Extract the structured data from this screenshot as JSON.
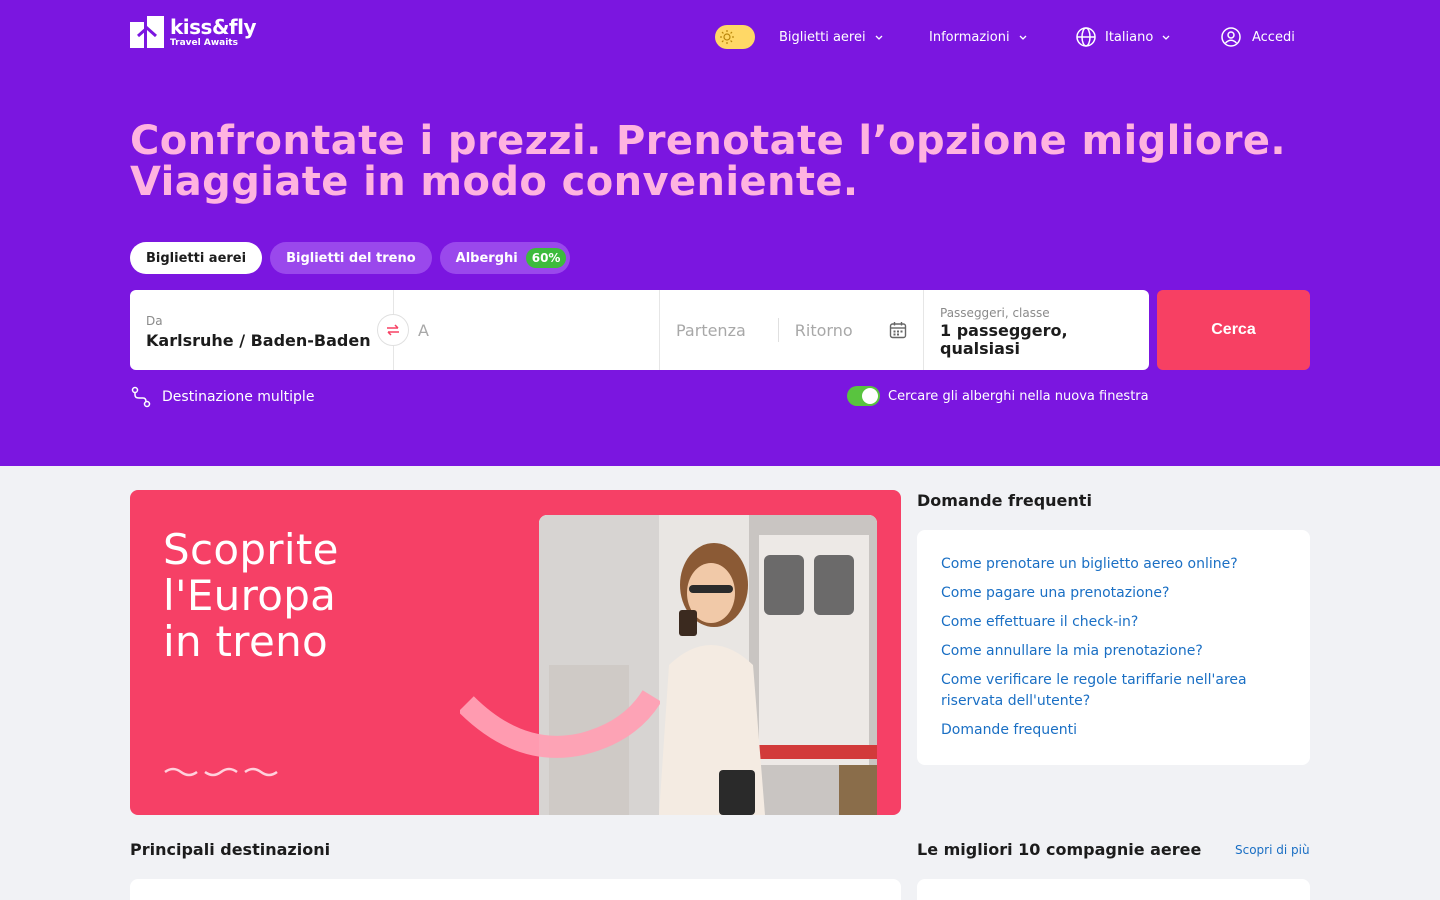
{
  "header": {
    "logo_name": "kiss&fly",
    "logo_tagline": "Travel Awaits",
    "nav": [
      {
        "label": "Biglietti aerei"
      },
      {
        "label": "Informazioni"
      },
      {
        "label": "Italiano"
      },
      {
        "label": "Accedi"
      }
    ]
  },
  "hero": {
    "title_line1": "Confrontate i prezzi. Prenotate l’opzione migliore.",
    "title_line2": "Viaggiate in modo conveniente."
  },
  "tabs": [
    {
      "label": "Biglietti aerei",
      "active": true
    },
    {
      "label": "Biglietti del treno",
      "active": false
    },
    {
      "label": "Alberghi",
      "badge": "60%",
      "active": false
    }
  ],
  "search": {
    "from_label": "Da",
    "from_value": "Karlsruhe / Baden-Baden",
    "to_placeholder": "A",
    "depart_placeholder": "Partenza",
    "return_placeholder": "Ritorno",
    "pax_label": "Passeggeri, classe",
    "pax_value": "1 passeggero, qualsiasi",
    "button": "Cerca",
    "multi_label": "Destinazione multiple",
    "hotel_toggle_label": "Cercare gli alberghi nella nuova finestra",
    "hotel_toggle_on": true
  },
  "banner": {
    "line1": "Scoprite",
    "line2": "l'Europa",
    "line3": "in treno"
  },
  "faq": {
    "title": "Domande frequenti",
    "items": [
      "Come prenotare un biglietto aereo online?",
      "Come pagare una prenotazione?",
      "Come effettuare il check-in?",
      "Come annullare la mia prenotazione?",
      "Come verificare le regole tariffarie nell'area riservata dell'utente?",
      "Domande frequenti"
    ]
  },
  "sections": {
    "destinations_title": "Principali destinazioni",
    "airlines_title": "Le migliori 10 compagnie aeree",
    "airlines_more": "Scopri di più"
  },
  "colors": {
    "hero_bg": "#7b16e0",
    "title_pink": "#ffb3e0",
    "accent_red": "#f74063",
    "link_blue": "#1a6fc4",
    "toggle_green": "#59c43f"
  }
}
